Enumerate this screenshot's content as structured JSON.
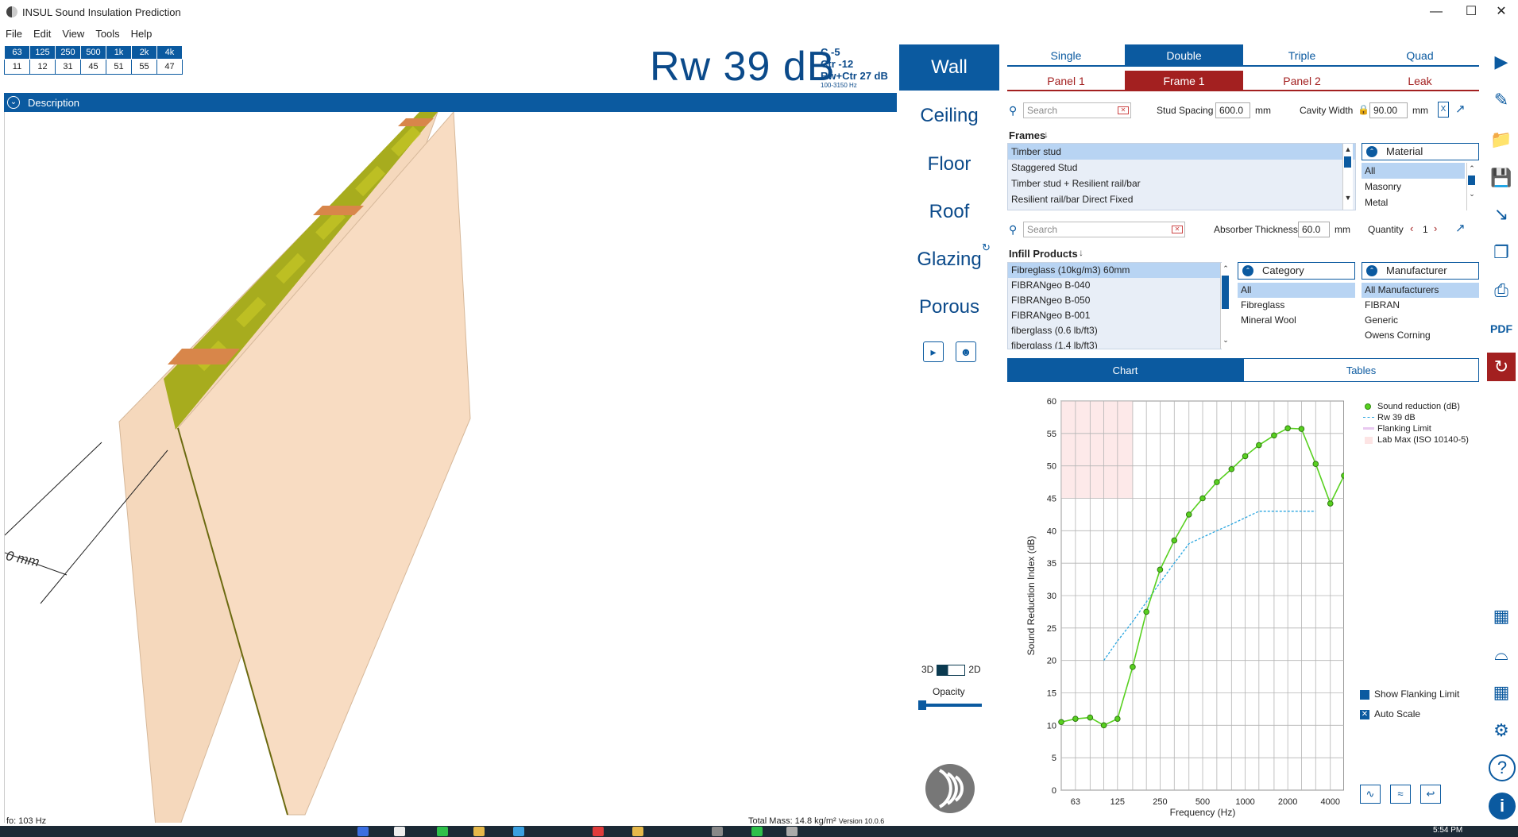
{
  "window": {
    "title": "INSUL Sound Insulation Prediction"
  },
  "menu": [
    "File",
    "Edit",
    "View",
    "Tools",
    "Help"
  ],
  "bands": {
    "headers": [
      "63",
      "125",
      "250",
      "500",
      "1k",
      "2k",
      "4k"
    ],
    "values": [
      "11",
      "12",
      "31",
      "45",
      "51",
      "55",
      "47"
    ]
  },
  "rating": {
    "main": "Rw 39 dB",
    "c": "C -5",
    "ctr": "Ctr -12",
    "rwctr": "Rw+Ctr 27 dB",
    "range": "100-3150 Hz"
  },
  "description": {
    "label": "Description"
  },
  "viewport": {
    "dim_label": "0 mm",
    "fo": "fo: 103 Hz",
    "mass": "Total Mass: 14.8 kg/m²",
    "version": "Version 10.0.6"
  },
  "nav": {
    "items": [
      "Wall",
      "Ceiling",
      "Floor",
      "Roof",
      "Glazing",
      "Porous"
    ],
    "toggle_3d": "3D",
    "toggle_2d": "2D",
    "opacity": "Opacity"
  },
  "tabs": {
    "layers": [
      "Single",
      "Double",
      "Triple",
      "Quad"
    ],
    "selected_layer": "Double",
    "panels": [
      "Panel 1",
      "Frame 1",
      "Panel 2",
      "Leak"
    ],
    "selected_panel": "Frame 1"
  },
  "frames": {
    "search_placeholder": "Search",
    "stud_spacing_label": "Stud Spacing",
    "stud_spacing": "600.0",
    "stud_unit": "mm",
    "cavity_label": "Cavity Width",
    "cavity": "90.00",
    "cavity_unit": "mm",
    "title": "Frames",
    "items": [
      "Timber stud",
      "Staggered Stud",
      "Timber stud + Resilient rail/bar",
      "Resilient rail/bar Direct Fixed"
    ],
    "material_title": "Material",
    "material_items": [
      "All",
      "Masonry",
      "Metal"
    ]
  },
  "infill": {
    "search_placeholder": "Search",
    "thickness_label": "Absorber Thickness",
    "thickness": "60.0",
    "thickness_unit": "mm",
    "quantity_label": "Quantity",
    "quantity": "1",
    "title": "Infill Products",
    "items": [
      "Fibreglass (10kg/m3) 60mm",
      "FIBRANgeo B-040",
      "FIBRANgeo B-050",
      "FIBRANgeo B-001",
      "fiberglass (0.6 lb/ft3)",
      "fiberglass (1.4 lb/ft3)"
    ],
    "category_title": "Category",
    "category_items": [
      "All",
      "Fibreglass",
      "Mineral Wool"
    ],
    "manufacturer_title": "Manufacturer",
    "manufacturer_items": [
      "All Manufacturers",
      "FIBRAN",
      "Generic",
      "Owens Corning"
    ]
  },
  "chart_tabs": [
    "Chart",
    "Tables"
  ],
  "chart_options": {
    "show_flanking": "Show Flanking Limit",
    "auto_scale": "Auto Scale"
  },
  "taskbar": {
    "time": "5:54 PM"
  },
  "colors": {
    "accent": "#0b5aa0",
    "panel_red": "#a32020",
    "curve": "#58d020",
    "rw_line": "#2aa6e0",
    "lab_max": "#fde4e4"
  },
  "chart_data": {
    "type": "line",
    "xlabel": "Frequency (Hz)",
    "ylabel": "Sound Reduction Index (dB)",
    "xscale": "log",
    "xlim": [
      50,
      5000
    ],
    "ylim": [
      0,
      60
    ],
    "xticks": [
      63,
      125,
      250,
      500,
      1000,
      2000,
      4000
    ],
    "yticks": [
      0,
      5,
      10,
      15,
      20,
      25,
      30,
      35,
      40,
      45,
      50,
      55,
      60
    ],
    "grid": true,
    "legend_position": "top-right",
    "series": [
      {
        "name": "Sound reduction (dB)",
        "x": [
          50,
          63,
          80,
          100,
          125,
          160,
          200,
          250,
          315,
          400,
          500,
          630,
          800,
          1000,
          1250,
          1600,
          2000,
          2500,
          3150,
          4000,
          5000
        ],
        "y": [
          10.5,
          11,
          11.2,
          10,
          11,
          19,
          27.5,
          34,
          38.5,
          42.5,
          45,
          47.5,
          49.5,
          51.5,
          53.2,
          54.7,
          55.8,
          55.7,
          50.3,
          44.2,
          48.5
        ]
      },
      {
        "name": "Rw 39 dB",
        "x": [
          100,
          125,
          160,
          200,
          250,
          315,
          400,
          500,
          630,
          800,
          1000,
          1250,
          1600,
          2000,
          2500,
          3150
        ],
        "y": [
          20,
          23,
          26,
          29,
          32,
          35,
          38,
          39,
          40,
          41,
          42,
          43,
          43,
          43,
          43,
          43
        ]
      },
      {
        "name": "Flanking Limit",
        "x": [],
        "y": []
      },
      {
        "name": "Lab Max (ISO 10140-5)",
        "region": {
          "x": [
            50,
            160
          ],
          "y": [
            45,
            60
          ]
        }
      }
    ]
  }
}
